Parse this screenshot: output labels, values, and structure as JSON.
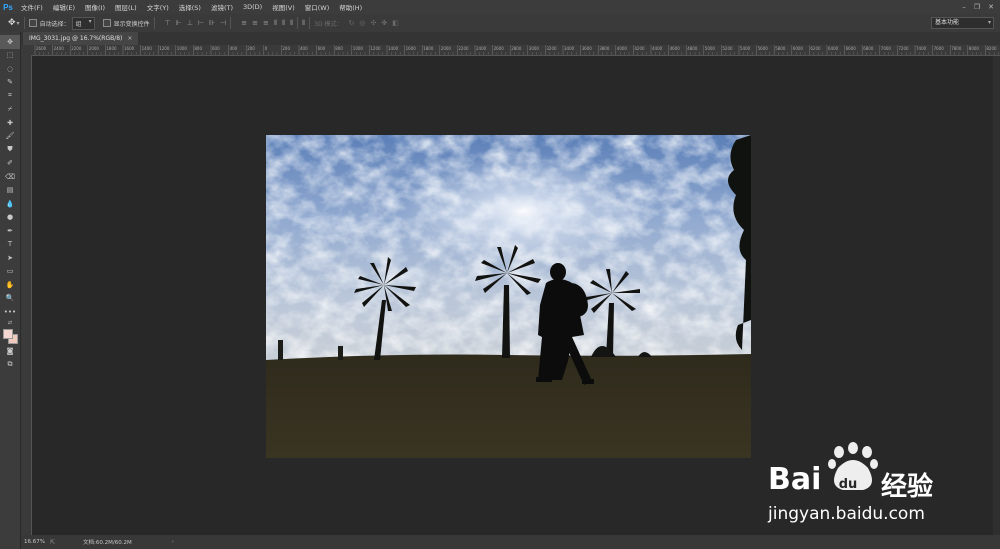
{
  "app": {
    "logo": "Ps"
  },
  "menu": [
    "文件(F)",
    "编辑(E)",
    "图像(I)",
    "图层(L)",
    "文字(Y)",
    "选择(S)",
    "滤镜(T)",
    "3D(D)",
    "视图(V)",
    "窗口(W)",
    "帮助(H)"
  ],
  "window_controls": [
    "–",
    "❐",
    "✕"
  ],
  "options": {
    "auto_select_label": "自动选择：",
    "auto_select_value": "组",
    "show_transform_label": "显示变换控件",
    "mode_3d_label": "3D 模式：",
    "workspace": "基本功能"
  },
  "document": {
    "tab_title": "IMG_3031.jpg @ 16.7%(RGB/8)",
    "tab_close": "×"
  },
  "ruler": {
    "top_ticks": [
      "2600",
      "2400",
      "2200",
      "2000",
      "1800",
      "1600",
      "1400",
      "1200",
      "1000",
      "800",
      "600",
      "400",
      "200",
      "0",
      "200",
      "400",
      "600",
      "800",
      "1000",
      "1200",
      "1400",
      "1600",
      "1800",
      "2000",
      "2200",
      "2400",
      "2600",
      "2800",
      "3000",
      "3200",
      "3400",
      "3600",
      "3800",
      "4000",
      "4200",
      "4400",
      "4600",
      "4800",
      "5000",
      "5200",
      "5400",
      "5600",
      "5800",
      "6000",
      "6200",
      "6400",
      "6600",
      "6800",
      "7000",
      "7200",
      "7400",
      "7600",
      "7800",
      "8000",
      "8200"
    ]
  },
  "status": {
    "zoom": "16.67%",
    "doc_size": "文档:60.2M/60.2M",
    "arrow": "›"
  },
  "watermark": {
    "brand_left": "Bai",
    "brand_right": "经验",
    "url": "jingyan.baidu.com"
  },
  "colors": {
    "foreground": "#f2d6cf",
    "background": "#f0c9bd",
    "ps_blue": "#31a8ff"
  }
}
